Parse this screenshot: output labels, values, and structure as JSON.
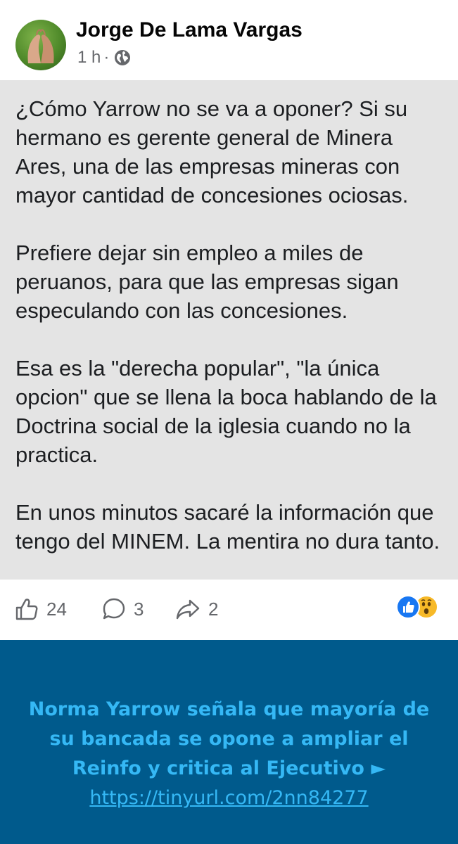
{
  "post": {
    "author": "Jorge De Lama Vargas",
    "time": "1 h",
    "separator": "·",
    "visibility_icon": "globe-icon",
    "paragraphs": [
      "¿Cómo Yarrow no se va a oponer? Si su hermano es gerente general de Minera Ares, una de las empresas mineras con mayor cantidad de concesiones ociosas.",
      "Prefiere dejar sin empleo a miles de peruanos, para que las empresas sigan especulando con las concesiones.",
      "Esa es la \"derecha popular\", \"la única opcion\" que se llena la boca hablando de la Doctrina social de la iglesia cuando no la practica.",
      "En unos minutos sacaré la información que tengo del MINEM. La mentira no dura tanto."
    ]
  },
  "actions": {
    "likes": "24",
    "comments": "3",
    "shares": "2",
    "reaction_icons": [
      "like-reaction-icon",
      "wow-reaction-icon"
    ]
  },
  "link_card": {
    "headline": "Norma Yarrow señala que mayoría de su bancada se opone a ampliar el Reinfo y critica al Ejecutivo ►",
    "url": "https://tinyurl.com/2nn84277"
  },
  "colors": {
    "body_background": "#e4e4e4",
    "card_background": "#005a8c",
    "card_text": "#35b8f5",
    "like_blue": "#1877f2",
    "wow_yellow": "#f7b928",
    "meta_gray": "#65676b"
  }
}
